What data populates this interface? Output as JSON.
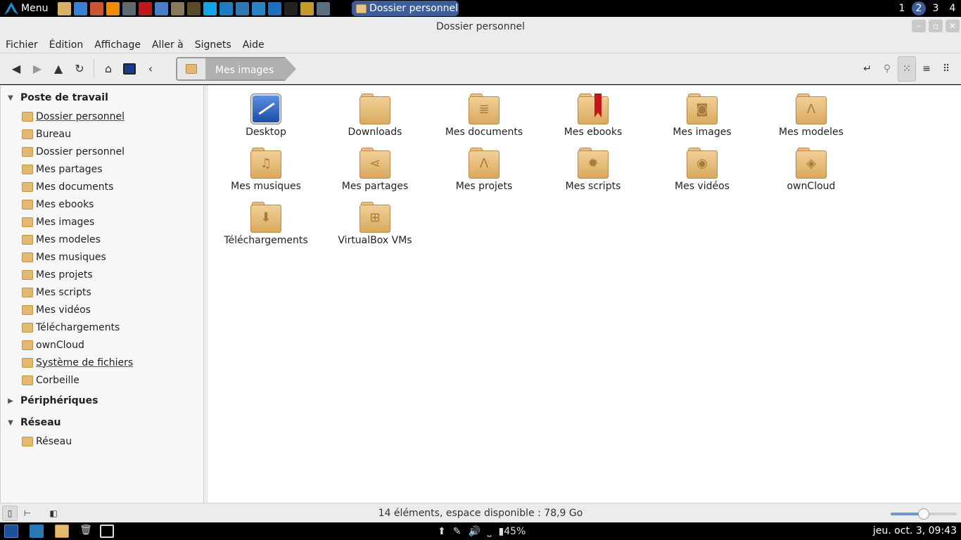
{
  "top_panel": {
    "menu_label": "Menu",
    "launchers": [
      {
        "icon": "files-icon",
        "color": "#d9b06a"
      },
      {
        "icon": "chromium-icon",
        "color": "#3b7fd6"
      },
      {
        "icon": "photos-icon",
        "color": "#cc5533"
      },
      {
        "icon": "vlc-icon",
        "color": "#f08a00"
      },
      {
        "icon": "settings-icon",
        "color": "#606870"
      },
      {
        "icon": "filezilla-icon",
        "color": "#c0171f"
      },
      {
        "icon": "document-icon",
        "color": "#4a7cc7"
      },
      {
        "icon": "gimp-icon",
        "color": "#8a7a5a"
      },
      {
        "icon": "sublime-icon",
        "color": "#5b4a2a"
      },
      {
        "icon": "skype-icon",
        "color": "#12a5e6"
      },
      {
        "icon": "remote-desktop-icon",
        "color": "#1f7dbf"
      },
      {
        "icon": "pencil-app-icon",
        "color": "#2a7ab8"
      },
      {
        "icon": "network-icon",
        "color": "#2a82c4"
      },
      {
        "icon": "calculator-icon",
        "color": "#1d6fc1"
      },
      {
        "icon": "terminal-icon",
        "color": "#222222"
      },
      {
        "icon": "headphones-icon",
        "color": "#c59a2a"
      },
      {
        "icon": "cloud-icon",
        "color": "#5a6f80"
      }
    ],
    "task_button_label": "Dossier personnel",
    "workspaces": [
      "1",
      "2",
      "3",
      "4"
    ],
    "active_workspace": "2"
  },
  "window": {
    "title": "Dossier personnel",
    "controls": [
      "minimize",
      "maximize",
      "close"
    ]
  },
  "menubar": [
    "Fichier",
    "Édition",
    "Affichage",
    "Aller à",
    "Signets",
    "Aide"
  ],
  "breadcrumb": {
    "current": "Mes images"
  },
  "sidebar": {
    "sections": [
      {
        "title": "Poste de travail",
        "expanded": true,
        "items": [
          {
            "label": "Dossier personnel",
            "icon": "home-folder-icon"
          },
          {
            "label": "Bureau",
            "icon": "desktop-icon"
          },
          {
            "label": "Dossier personnel",
            "icon": "home-folder-icon"
          },
          {
            "label": "Mes partages",
            "icon": "share-folder-icon"
          },
          {
            "label": "Mes documents",
            "icon": "documents-folder-icon"
          },
          {
            "label": "Mes ebooks",
            "icon": "ebooks-folder-icon"
          },
          {
            "label": "Mes images",
            "icon": "pictures-folder-icon"
          },
          {
            "label": "Mes modeles",
            "icon": "templates-folder-icon"
          },
          {
            "label": "Mes musiques",
            "icon": "music-folder-icon"
          },
          {
            "label": "Mes projets",
            "icon": "projects-folder-icon"
          },
          {
            "label": "Mes scripts",
            "icon": "scripts-folder-icon"
          },
          {
            "label": "Mes vidéos",
            "icon": "videos-folder-icon"
          },
          {
            "label": "Téléchargements",
            "icon": "downloads-folder-icon"
          },
          {
            "label": "ownCloud",
            "icon": "owncloud-folder-icon"
          },
          {
            "label": "Système de fichiers",
            "icon": "drive-icon"
          },
          {
            "label": "Corbeille",
            "icon": "trash-icon"
          }
        ]
      },
      {
        "title": "Périphériques",
        "expanded": false,
        "items": []
      },
      {
        "title": "Réseau",
        "expanded": true,
        "items": [
          {
            "label": "Réseau",
            "icon": "network-icon"
          }
        ]
      }
    ]
  },
  "files": [
    {
      "label": "Desktop",
      "icon": "desktop-icon"
    },
    {
      "label": "Downloads",
      "icon": "folder-icon"
    },
    {
      "label": "Mes documents",
      "icon": "documents-folder-icon"
    },
    {
      "label": "Mes ebooks",
      "icon": "ebooks-folder-icon"
    },
    {
      "label": "Mes images",
      "icon": "pictures-folder-icon"
    },
    {
      "label": "Mes modeles",
      "icon": "templates-folder-icon"
    },
    {
      "label": "Mes musiques",
      "icon": "music-folder-icon"
    },
    {
      "label": "Mes partages",
      "icon": "share-folder-icon"
    },
    {
      "label": "Mes projets",
      "icon": "projects-folder-icon"
    },
    {
      "label": "Mes scripts",
      "icon": "scripts-folder-icon"
    },
    {
      "label": "Mes vidéos",
      "icon": "videos-folder-icon"
    },
    {
      "label": "ownCloud",
      "icon": "owncloud-folder-icon"
    },
    {
      "label": "Téléchargements",
      "icon": "downloads-folder-icon"
    },
    {
      "label": "VirtualBox VMs",
      "icon": "windows-folder-icon"
    }
  ],
  "statusbar": {
    "text": "14 éléments, espace disponible : 78,9 Go",
    "zoom_fraction": 0.5
  },
  "bottom_panel": {
    "battery": "45%",
    "clock": "jeu. oct.  3, 09:43"
  },
  "colors": {
    "accent": "#3d5e99",
    "folder": "#e3b96f"
  }
}
